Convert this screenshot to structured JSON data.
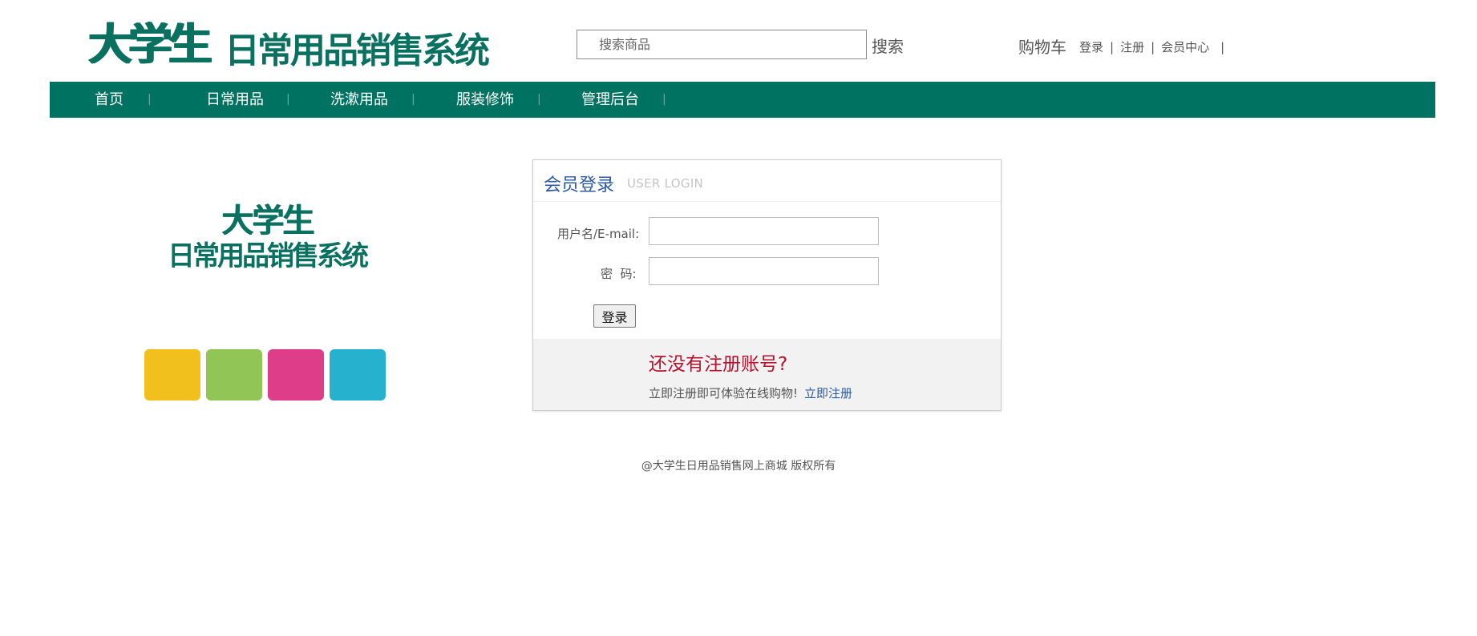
{
  "header": {
    "logo_part1": "大学生",
    "logo_part2": "日常用品销售系统",
    "search_placeholder": "搜索商品",
    "search_button": "搜索",
    "cart": "购物车",
    "links": [
      "登录",
      "注册",
      "会员中心"
    ],
    "separator": "|"
  },
  "nav": {
    "items": [
      "首页",
      "日常用品",
      "洗漱用品",
      "服装修饰",
      "管理后台"
    ],
    "separator": "|"
  },
  "side": {
    "logo_line1": "大学生",
    "logo_line2": "日常用品销售系统",
    "tile_colors": [
      "#f1c01c",
      "#91c656",
      "#dd3d89",
      "#26b1cf"
    ]
  },
  "login": {
    "title": "会员登录",
    "subtitle": "USER LOGIN",
    "username_label": "用户名/E-mail:",
    "password_label": "密  码:",
    "submit": "登录",
    "register_title": "还没有注册账号?",
    "register_text": "立即注册即可体验在线购物!",
    "register_link": "立即注册"
  },
  "footer": {
    "text": "@大学生日用品销售网上商城 版权所有"
  },
  "colors": {
    "brand_green": "#007262",
    "title_blue": "#2d5aa0",
    "register_red": "#b4122e"
  }
}
